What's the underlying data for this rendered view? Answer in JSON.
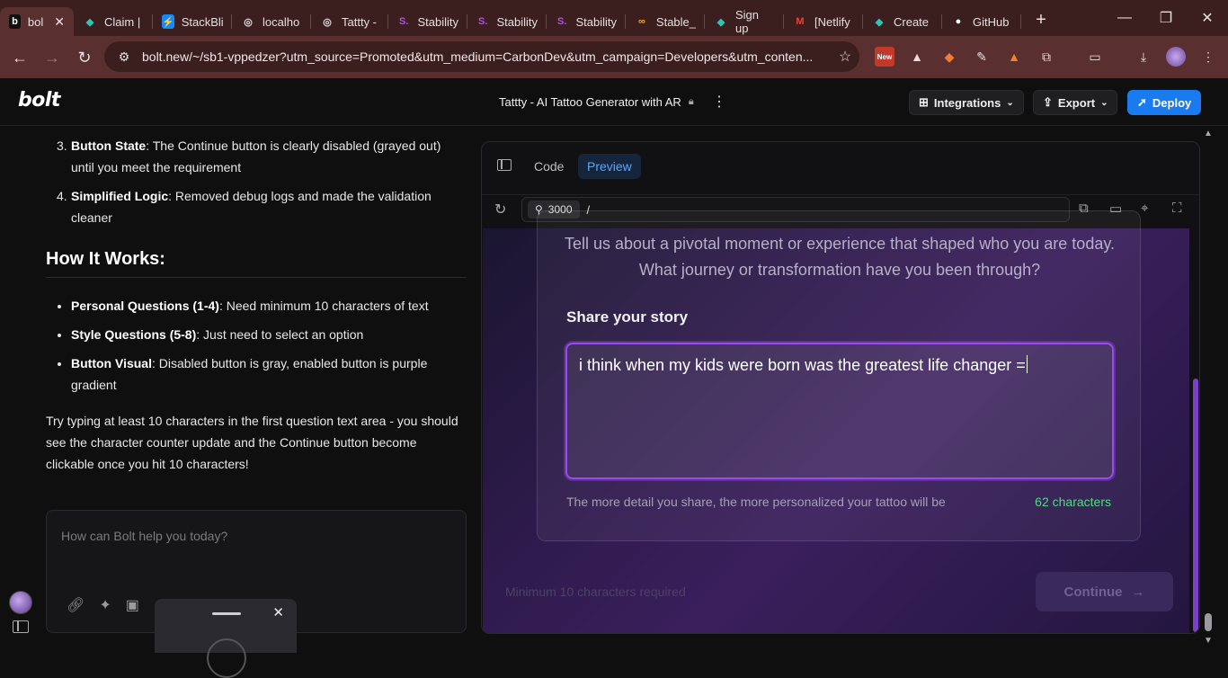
{
  "browser": {
    "tabs": [
      {
        "label": "bol",
        "favicon": "b"
      },
      {
        "label": "Claim |",
        "favicon": "◆"
      },
      {
        "label": "StackBli",
        "favicon": "⚡"
      },
      {
        "label": "localho",
        "favicon": "◎"
      },
      {
        "label": "Tattty -",
        "favicon": "◎"
      },
      {
        "label": "Stability",
        "favicon": "S."
      },
      {
        "label": "Stability",
        "favicon": "S."
      },
      {
        "label": "Stability",
        "favicon": "S."
      },
      {
        "label": "Stable_",
        "favicon": "∞"
      },
      {
        "label": "Sign up",
        "favicon": "◆"
      },
      {
        "label": "[Netlify",
        "favicon": "M"
      },
      {
        "label": "Create",
        "favicon": "◆"
      },
      {
        "label": "GitHub",
        "favicon": "●"
      }
    ],
    "url": "bolt.new/~/sb1-vppedzer?utm_source=Promoted&utm_medium=CarbonDev&utm_campaign=Developers&utm_conten...",
    "new_badge": "New"
  },
  "header": {
    "logo": "bolt",
    "project_title": "Tattty - AI Tattoo Generator with AR",
    "integrations_label": "Integrations",
    "export_label": "Export",
    "deploy_label": "Deploy"
  },
  "chat": {
    "list1": [
      {
        "num": "3.",
        "bold": "Button State",
        "text": ": The Continue button is clearly disabled (grayed out) until you meet the requirement"
      },
      {
        "num": "4.",
        "bold": "Simplified Logic",
        "text": ": Removed debug logs and made the validation cleaner"
      }
    ],
    "heading": "How It Works:",
    "list2": [
      {
        "bold": "Personal Questions (1-4)",
        "text": ": Need minimum 10 characters of text"
      },
      {
        "bold": "Style Questions (5-8)",
        "text": ": Just need to select an option"
      },
      {
        "bold": "Button Visual",
        "text": ": Disabled button is gray, enabled button is purple gradient"
      }
    ],
    "paragraph": "Try typing at least 10 characters in the first question text area - you should see the character counter update and the Continue button become clickable once you hit 10 characters!",
    "prompt_placeholder": "How can Bolt help you today?"
  },
  "preview": {
    "tab_code": "Code",
    "tab_preview": "Preview",
    "port": "3000",
    "path": "/",
    "question": "Tell us about a pivotal moment or experience that shaped who you are today. What journey or transformation have you been through?",
    "field_label": "Share your story",
    "field_value": "i think when my kids were born was the greatest life changer =",
    "hint": "The more detail you share, the more personalized your tattoo will be",
    "char_count": "62 characters",
    "min_required": "Minimum 10 characters required",
    "continue_label": "Continue"
  }
}
